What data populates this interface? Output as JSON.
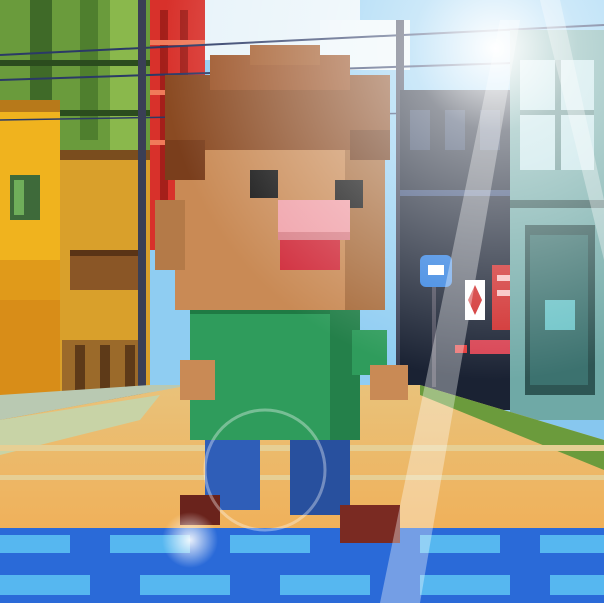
{
  "scene": {
    "kind": "voxel street scene",
    "palette": {
      "sky": "#8fcdf2",
      "cloud": "#e8f4fa",
      "building_left_yellow": "#f0b31e",
      "building_left_green": "#6a9b3c",
      "building_red_tower": "#d8312b",
      "building_right_dark": "#1a2233",
      "building_right_teal": "#6fa9a6",
      "road_orange": "#f1b552",
      "crosswalk_blue": "#2a6ad8",
      "crosswalk_light": "#56b7f0",
      "skin": "#c98a55",
      "hair": "#8a4a22",
      "nose": "#f0a0a8",
      "mouth": "#d02a3a",
      "shirt": "#2f9c5c",
      "pants": "#2f5eb8",
      "shoe": "#7a2a22"
    }
  },
  "signage": {
    "icons": [
      "round-blue-street-sign-icon",
      "red-diamond-sign-icon",
      "red-panel-sign-icon"
    ]
  }
}
